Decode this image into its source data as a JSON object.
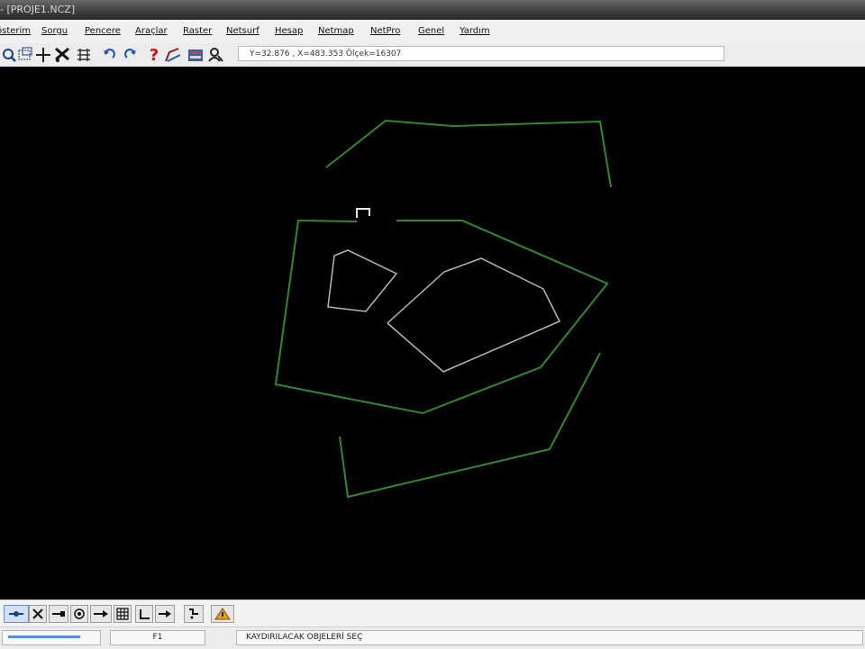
{
  "window": {
    "title": "- [PROJE1.NCZ]"
  },
  "menu": {
    "items": [
      "Gösterim",
      "Sorgu",
      "Pencere",
      "Araçlar",
      "Raster",
      "Netsurf",
      "Hesap",
      "Netmap",
      "NetPro",
      "Genel",
      "Yardım"
    ],
    "first_visible": "österim"
  },
  "toolbar": {
    "icons": [
      "zoom-icon",
      "select-window-icon",
      "crosshair-icon",
      "scissors-icon",
      "grid-tool-icon",
      "undo-icon",
      "redo-icon",
      "help-icon",
      "pen-icon",
      "database-icon",
      "user-search-icon"
    ],
    "coord_text": "Y=32.876 , X=483.353 Ölçek=16307"
  },
  "canvas": {
    "background": "#000000",
    "green": "#2f8a2f",
    "grey": "#b8b8b8"
  },
  "bottom_toolbar": {
    "icons": [
      "snap-point-icon",
      "snap-cross-icon",
      "snap-end-icon",
      "snap-center-icon",
      "snap-arrow-icon",
      "snap-grid-icon",
      "snap-perp-icon",
      "snap-next-icon",
      "snap-step-icon",
      "warning-icon"
    ]
  },
  "status": {
    "f_key": "F1",
    "message": "KAYDIRILACAK OBJELERİ SEÇ"
  }
}
